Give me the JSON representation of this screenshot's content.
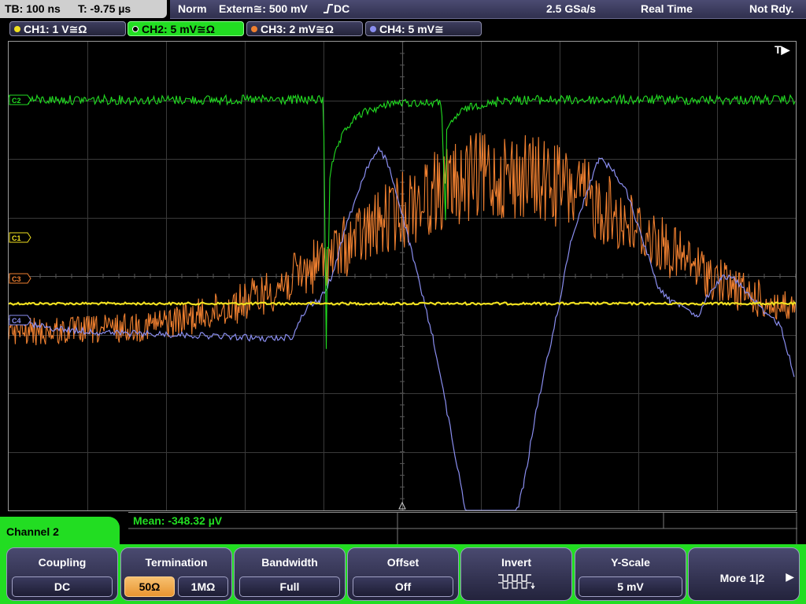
{
  "topbar": {
    "timebase": "TB: 100 ns",
    "trigger_time": "T: -9.75 µs",
    "mode": "Norm",
    "trigger_source": "Extern≅: 500 mV",
    "trigger_coupling": "DC",
    "sample_rate": "2.5 GSa/s",
    "acquisition": "Real Time",
    "status": "Not Rdy."
  },
  "channels": [
    {
      "label": "CH1: 1 V≅Ω",
      "color": "#f0e020"
    },
    {
      "label": "CH2: 5 mV≅Ω",
      "color": "#22dd22"
    },
    {
      "label": "CH3: 2 mV≅Ω",
      "color": "#f08030"
    },
    {
      "label": "CH4: 5 mV≅",
      "color": "#8a8ef0"
    }
  ],
  "markers": {
    "ch1": "C1",
    "ch2": "C2",
    "ch3": "C3",
    "ch4": "C4",
    "trigger": "T▶"
  },
  "measurement": {
    "text": "Mean: -348.32 µV"
  },
  "menu": {
    "title": "Channel 2",
    "coupling_label": "Coupling",
    "coupling_value": "DC",
    "termination_label": "Termination",
    "termination_opt1": "50Ω",
    "termination_opt2": "1MΩ",
    "bandwidth_label": "Bandwidth",
    "bandwidth_value": "Full",
    "offset_label": "Offset",
    "offset_value": "Off",
    "invert_label": "Invert",
    "yscale_label": "Y-Scale",
    "yscale_value": "5 mV",
    "more_label": "More 1|2",
    "more_arrow": "▶"
  },
  "colors": {
    "ch1": "#f0e020",
    "ch2": "#22dd22",
    "ch3": "#f08030",
    "ch4": "#8a8ef0",
    "grid": "#3a3a3a",
    "active_channel_bg": "#22dd22"
  }
}
